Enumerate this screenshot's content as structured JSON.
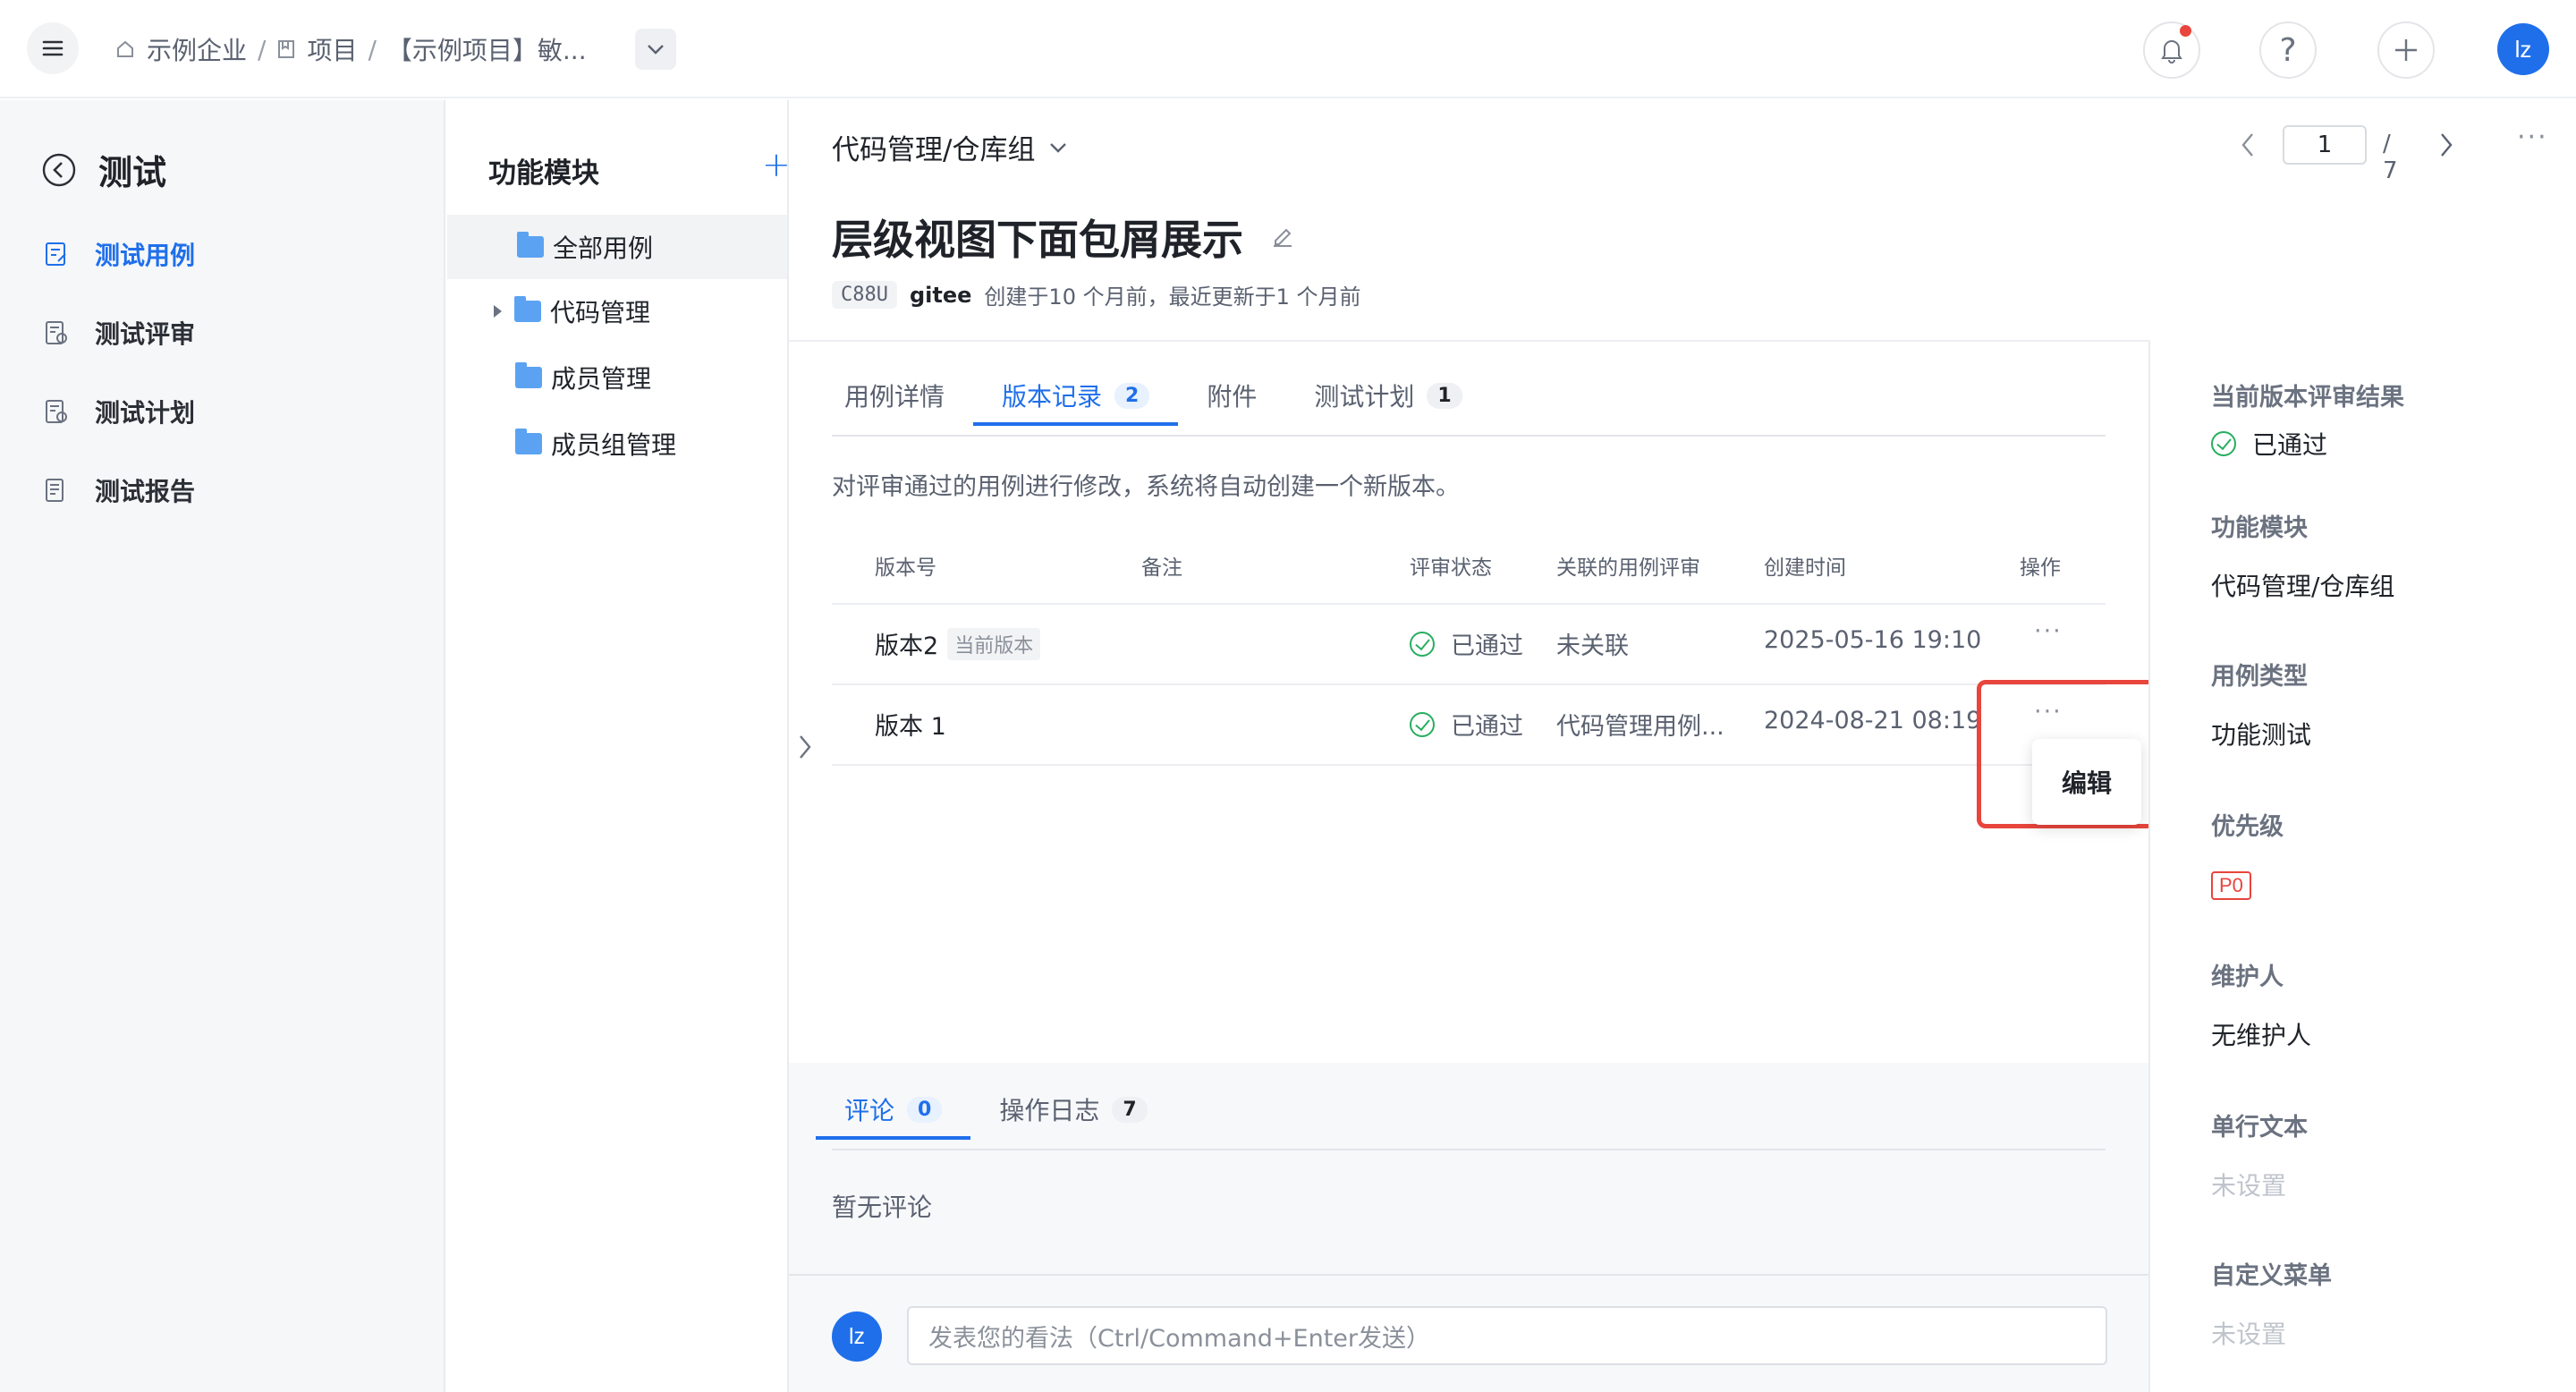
{
  "breadcrumb": {
    "org": "示例企业",
    "projects": "项目",
    "project": "【示例项目】敏..."
  },
  "user": {
    "initials": "lz"
  },
  "nav": {
    "title": "测试",
    "items": [
      {
        "label": "测试用例",
        "active": true
      },
      {
        "label": "测试评审"
      },
      {
        "label": "测试计划"
      },
      {
        "label": "测试报告"
      }
    ]
  },
  "modules": {
    "title": "功能模块",
    "items": [
      "全部用例",
      "代码管理",
      "成员管理",
      "成员组管理"
    ]
  },
  "header": {
    "path": "代码管理/仓库组",
    "page_current": "1",
    "page_total": "/ 7"
  },
  "case": {
    "title": "层级视图下面包屑展示",
    "id": "C88U",
    "author": "gitee",
    "meta": "创建于10 个月前，最近更新于1 个月前"
  },
  "tabs": [
    {
      "label": "用例详情",
      "count": ""
    },
    {
      "label": "版本记录",
      "count": "2"
    },
    {
      "label": "附件",
      "count": ""
    },
    {
      "label": "测试计划",
      "count": "1"
    }
  ],
  "version_note": "对评审通过的用例进行修改，系统将自动创建一个新版本。",
  "table": {
    "headers": [
      "版本号",
      "备注",
      "评审状态",
      "关联的用例评审",
      "创建时间",
      "操作"
    ],
    "rows": [
      {
        "version": "版本2",
        "tag": "当前版本",
        "status": "已通过",
        "review": "未关联",
        "time": "2025-05-16 19:10"
      },
      {
        "version": "版本 1",
        "tag": "",
        "status": "已通过",
        "review": "代码管理用例...",
        "time": "2024-08-21 08:19"
      }
    ]
  },
  "popover": {
    "edit": "编辑"
  },
  "bottom_tabs": [
    {
      "label": "评论",
      "count": "0"
    },
    {
      "label": "操作日志",
      "count": "7"
    }
  ],
  "comments": {
    "empty": "暂无评论",
    "placeholder": "发表您的看法（Ctrl/Command+Enter发送）"
  },
  "props": [
    {
      "label": "当前版本评审结果",
      "value": "已通过"
    },
    {
      "label": "功能模块",
      "value": "代码管理/仓库组"
    },
    {
      "label": "用例类型",
      "value": "功能测试"
    },
    {
      "label": "优先级",
      "value": "P0"
    },
    {
      "label": "维护人",
      "value": "无维护人"
    },
    {
      "label": "单行文本",
      "value": "未设置"
    },
    {
      "label": "自定义菜单",
      "value": "未设置"
    }
  ],
  "colors": {
    "accent": "#1f6feb",
    "success": "#27ae60",
    "danger": "#e8453c"
  }
}
